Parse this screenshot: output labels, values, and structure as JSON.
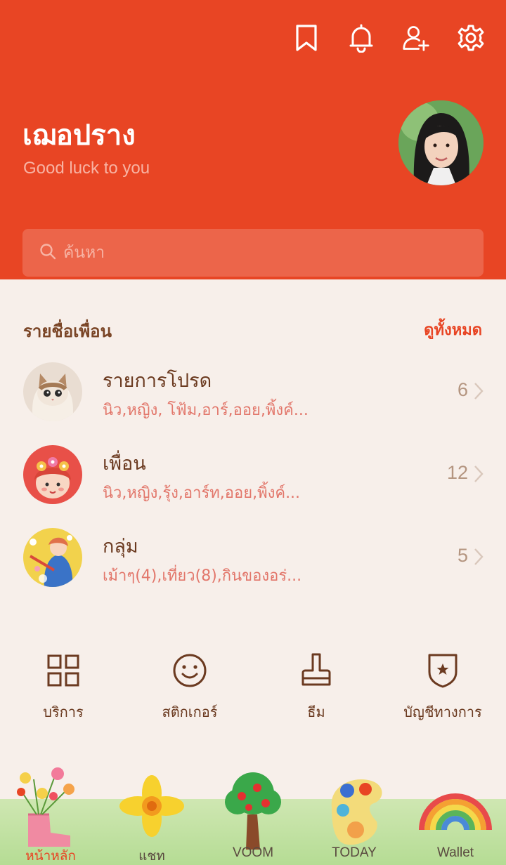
{
  "header": {
    "icons": [
      "bookmark-icon",
      "bell-icon",
      "add-friend-icon",
      "gear-icon"
    ],
    "profile_name": "เฌอปราง",
    "status_message": "Good luck to you",
    "search_placeholder": "ค้นหา",
    "bg_color": "#e84524"
  },
  "friends": {
    "section_title": "รายชื่อเพื่อน",
    "see_all": "ดูทั้งหมด",
    "rows": [
      {
        "title": "รายการโปรด",
        "sub": "นิว,หญิง, โฟ้ม,อาร์,ออย,พิ้งค์...",
        "count": "6"
      },
      {
        "title": "เพื่อน",
        "sub": "นิว,หญิง,รุ้ง,อาร์ท,ออย,พิ้งค์...",
        "count": "12"
      },
      {
        "title": "กลุ่ม",
        "sub": "เม้าๆ(4),เที่ยว(8),กินของอร่...",
        "count": "5"
      }
    ]
  },
  "shortcuts": [
    {
      "label": "บริการ",
      "icon": "grid-icon"
    },
    {
      "label": "สติกเกอร์",
      "icon": "smile-icon"
    },
    {
      "label": "ธีม",
      "icon": "brush-icon"
    },
    {
      "label": "บัญชีทางการ",
      "icon": "shield-star-icon"
    }
  ],
  "tabs": [
    {
      "label": "หน้าหลัก",
      "active": true
    },
    {
      "label": "แชท",
      "active": false
    },
    {
      "label": "VOOM",
      "active": false
    },
    {
      "label": "TODAY",
      "active": false
    },
    {
      "label": "Wallet",
      "active": false
    }
  ]
}
